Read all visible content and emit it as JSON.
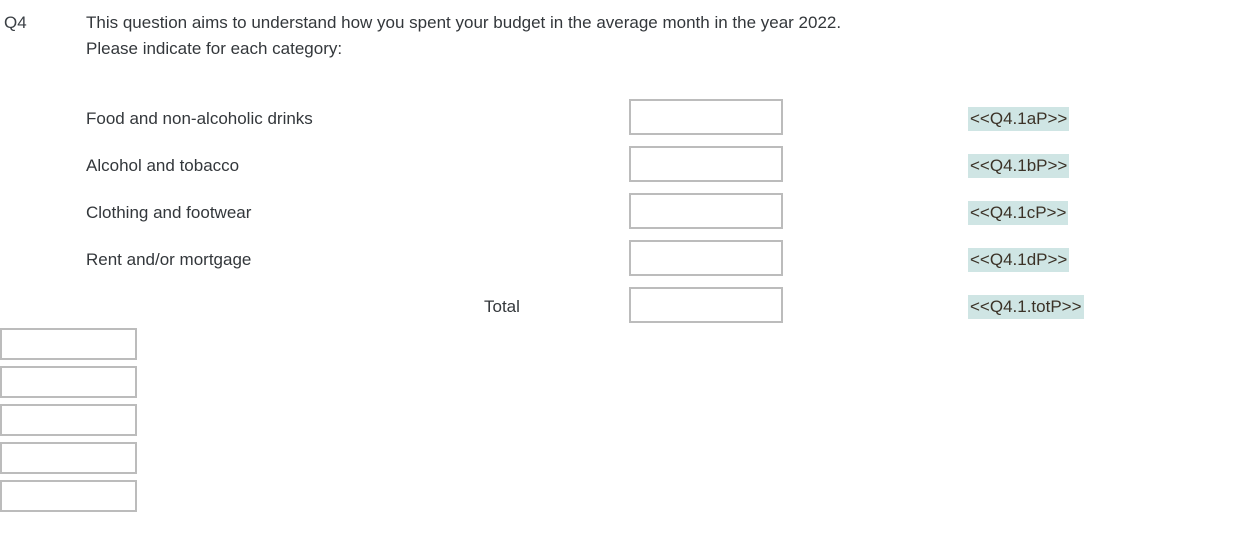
{
  "question": {
    "number": "Q4",
    "text_lines": [
      "This question aims to understand how you spent your budget in the average month in the year 2022.",
      "Please indicate for each category:"
    ]
  },
  "colors": {
    "highlight": "#cfe5e4",
    "box_border": "#bcbcbc",
    "text": "#33373b",
    "tag_text": "#3b3227",
    "page_background": "#ffffff"
  },
  "rows": [
    {
      "label": "Food and non-alcoholic drinks",
      "value": "",
      "placeholder": "",
      "tag": "<<Q4.1aP>>"
    },
    {
      "label": "Alcohol and tobacco",
      "value": "",
      "placeholder": "",
      "tag": "<<Q4.1bP>>"
    },
    {
      "label": "Clothing and footwear",
      "value": "",
      "placeholder": "",
      "tag": "<<Q4.1cP>>"
    },
    {
      "label": "Rent and/or mortgage",
      "value": "",
      "placeholder": "",
      "tag": "<<Q4.1dP>>"
    },
    {
      "label": "Total",
      "value": "",
      "placeholder": "",
      "tag": "<<Q4.1.totP>>"
    }
  ],
  "bottom_boxes": [
    {
      "value": "",
      "placeholder": ""
    },
    {
      "value": "",
      "placeholder": ""
    },
    {
      "value": "",
      "placeholder": ""
    },
    {
      "value": "",
      "placeholder": ""
    },
    {
      "value": "",
      "placeholder": ""
    }
  ]
}
